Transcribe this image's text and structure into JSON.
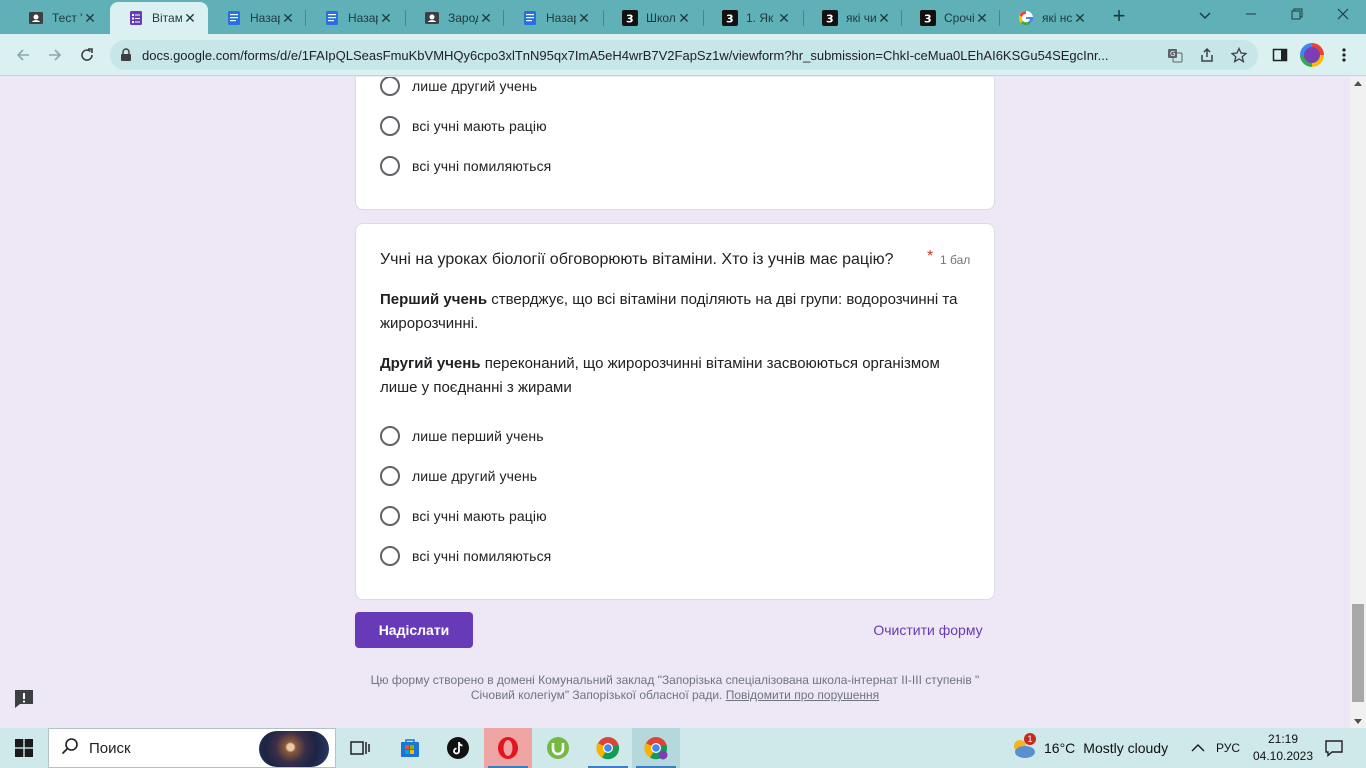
{
  "browser": {
    "tabs": [
      {
        "label": "Тест '",
        "icon": "doc-icon"
      },
      {
        "label": "Вітам",
        "icon": "forms-icon",
        "active": true
      },
      {
        "label": "Назар",
        "icon": "docs-icon"
      },
      {
        "label": "Назар",
        "icon": "docs-icon"
      },
      {
        "label": "Зарод",
        "icon": "doc-icon"
      },
      {
        "label": "Назар",
        "icon": "docs-icon"
      },
      {
        "label": "Школ",
        "icon": "znanija-icon"
      },
      {
        "label": "1. Як",
        "icon": "znanija-icon"
      },
      {
        "label": "які чи",
        "icon": "znanija-icon"
      },
      {
        "label": "Срочі",
        "icon": "znanija-icon"
      },
      {
        "label": "які нс",
        "icon": "google-icon"
      }
    ],
    "close_glyph": "✕",
    "new_tab_glyph": "+",
    "url": "docs.google.com/forms/d/e/1FAIpQLSeasFmuKbVMHQy6cpo3xlTnN95qx7ImA5eH4wrB7V2FapSz1w/viewform?hr_submission=ChkI-ceMua0LEhAI6KSGu54SEgcInr...",
    "colors": {
      "frame": "#5fb0b7",
      "toolbar": "#daf0f1"
    }
  },
  "form": {
    "prev_options": [
      "лише другий учень",
      "всі учні мають рацію",
      "всі учні помиляються"
    ],
    "question": {
      "title": "Учні на уроках біології обговорюють вітаміни. Хто із учнів має рацію?",
      "required_mark": "*",
      "points": "1 бал",
      "p1_bold": "Перший учень",
      "p1_text": " стверджує, що всі вітаміни поділяють на дві групи: водорозчинні та жиророзчинні.",
      "p2_bold": "Другий учень",
      "p2_text": " переконаний, що жиророзчинні вітаміни засвоюються організмом лише у поєднанні з жирами",
      "options": [
        "лише перший учень",
        "лише другий учень",
        "всі учні мають рацію",
        "всі учні помиляються"
      ]
    },
    "submit_label": "Надіслати",
    "clear_label": "Очистити форму",
    "footer_text": "Цю форму створено в домені Комунальний заклад \"Запорізька спеціалізована школа-інтернат ІІ-ІІІ ступенів \" Січовий колегіум\" Запорізької обласної ради. ",
    "footer_link": "Повідомити про порушення",
    "accent": "#673ab7",
    "background": "#ede7f6"
  },
  "taskbar": {
    "search_placeholder": "Поиск",
    "weather_temp": "16°C",
    "weather_text": "Mostly cloudy",
    "weather_badge": "1",
    "language": "РУС",
    "time": "21:19",
    "date": "04.10.2023"
  }
}
